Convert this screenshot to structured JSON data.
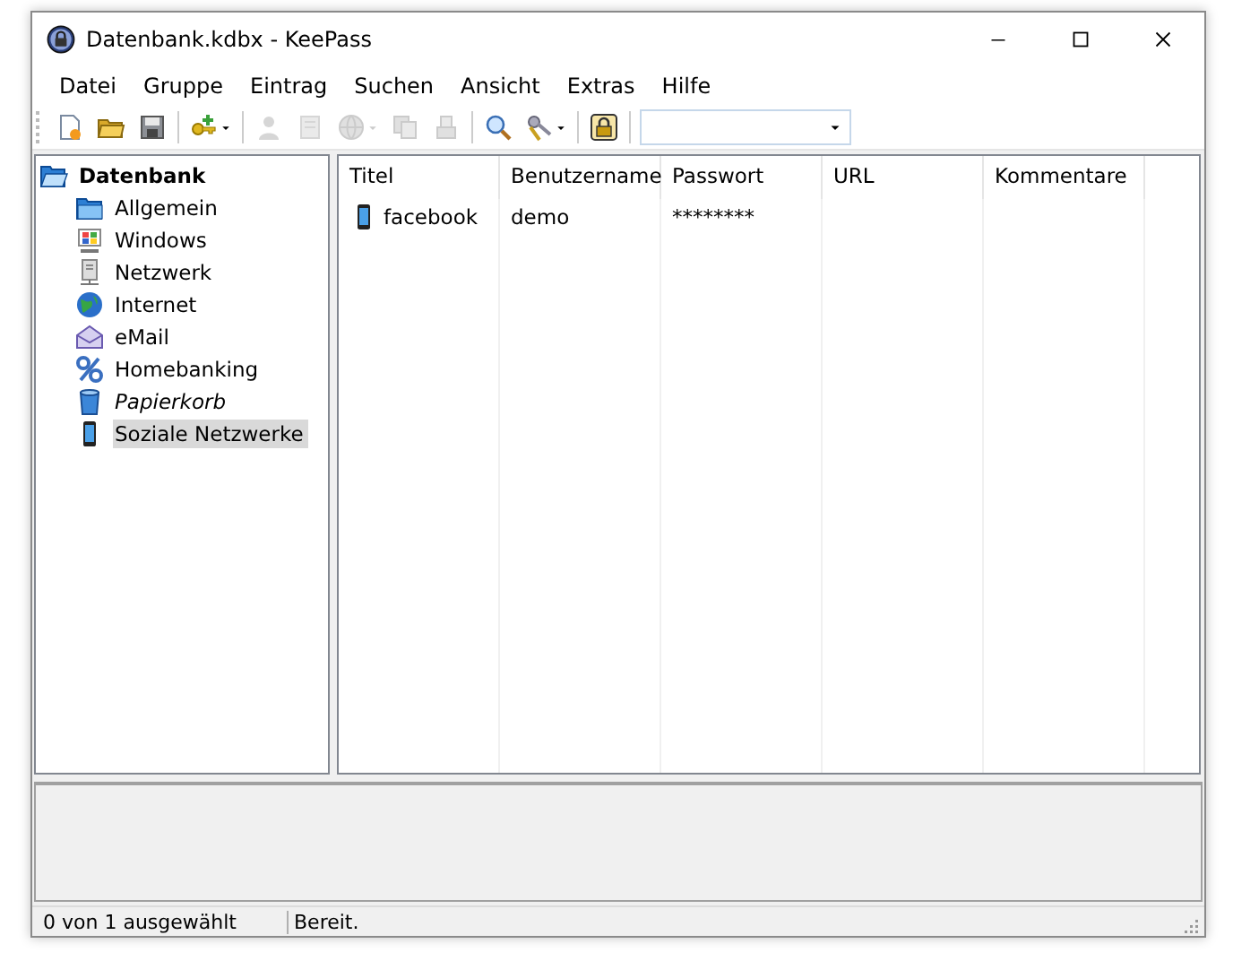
{
  "window": {
    "title": "Datenbank.kdbx - KeePass"
  },
  "menu": [
    {
      "label": "Datei"
    },
    {
      "label": "Gruppe"
    },
    {
      "label": "Eintrag"
    },
    {
      "label": "Suchen"
    },
    {
      "label": "Ansicht"
    },
    {
      "label": "Extras"
    },
    {
      "label": "Hilfe"
    }
  ],
  "toolbar": [
    {
      "kind": "button",
      "disabled": false,
      "dropdown": false
    },
    {
      "kind": "button",
      "disabled": false,
      "dropdown": false
    },
    {
      "kind": "button",
      "disabled": false,
      "dropdown": false
    },
    {
      "kind": "separator"
    },
    {
      "kind": "button",
      "disabled": false,
      "dropdown": true
    },
    {
      "kind": "separator"
    },
    {
      "kind": "button",
      "disabled": true,
      "dropdown": false
    },
    {
      "kind": "button",
      "disabled": true,
      "dropdown": false
    },
    {
      "kind": "button",
      "disabled": true,
      "dropdown": true
    },
    {
      "kind": "button",
      "disabled": true,
      "dropdown": false
    },
    {
      "kind": "button",
      "disabled": true,
      "dropdown": false
    },
    {
      "kind": "separator"
    },
    {
      "kind": "button",
      "disabled": false,
      "dropdown": false
    },
    {
      "kind": "button",
      "disabled": false,
      "dropdown": true
    },
    {
      "kind": "separator"
    },
    {
      "kind": "button",
      "disabled": false,
      "dropdown": false
    },
    {
      "kind": "separator"
    },
    {
      "kind": "search"
    }
  ],
  "tree": {
    "label": "Datenbank",
    "expanded": true,
    "selected": false,
    "children": [
      {
        "label": "Allgemein",
        "kind": "group",
        "selected": false
      },
      {
        "label": "Windows",
        "kind": "group",
        "selected": false
      },
      {
        "label": "Netzwerk",
        "kind": "group",
        "selected": false
      },
      {
        "label": "Internet",
        "kind": "group",
        "selected": false
      },
      {
        "label": "eMail",
        "kind": "group",
        "selected": false
      },
      {
        "label": "Homebanking",
        "kind": "group",
        "selected": false
      },
      {
        "label": "Papierkorb",
        "kind": "recycle-bin",
        "selected": false
      },
      {
        "label": "Soziale Netzwerke",
        "kind": "group",
        "selected": true
      }
    ]
  },
  "table": {
    "columns": [
      "Titel",
      "Benutzername",
      "Passwort",
      "URL",
      "Kommentare"
    ],
    "rows": [
      {
        "cells": [
          "facebook",
          "demo",
          "********",
          "",
          ""
        ],
        "selected": false
      }
    ]
  },
  "status_bar": [
    "0 von 1 ausgewählt",
    "Bereit."
  ]
}
